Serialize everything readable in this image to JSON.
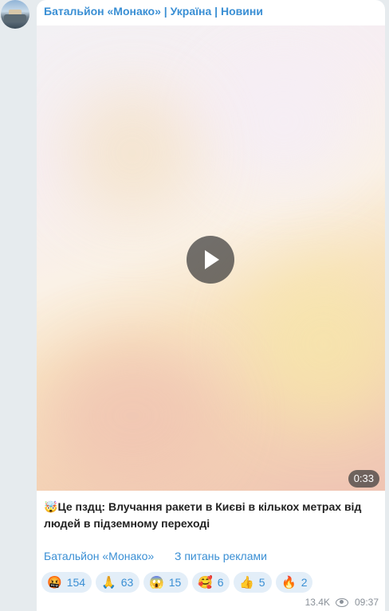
{
  "channel": {
    "name": "Батальйон «Монако» | Україна | Новини",
    "avatar_icon": "channel-avatar"
  },
  "video": {
    "duration": "0:33",
    "play_icon": "play-icon"
  },
  "caption": {
    "emoji": "🤯",
    "text": "Це пздц: Влучання ракети в Києві в кількох метрах від людей в підземному переході"
  },
  "links": {
    "channel_link": "Батальйон «Монако»",
    "ads_link": "З питань реклами"
  },
  "reactions": [
    {
      "emoji": "🤬",
      "count": "154"
    },
    {
      "emoji": "🙏",
      "count": "63"
    },
    {
      "emoji": "😱",
      "count": "15"
    },
    {
      "emoji": "🥰",
      "count": "6"
    },
    {
      "emoji": "👍",
      "count": "5"
    },
    {
      "emoji": "🔥",
      "count": "2"
    }
  ],
  "meta": {
    "views": "13.4K",
    "time": "09:37"
  },
  "colors": {
    "accent": "#3a8fd4",
    "reaction_bg": "#e3eef8",
    "page_bg": "#e6ebee"
  }
}
